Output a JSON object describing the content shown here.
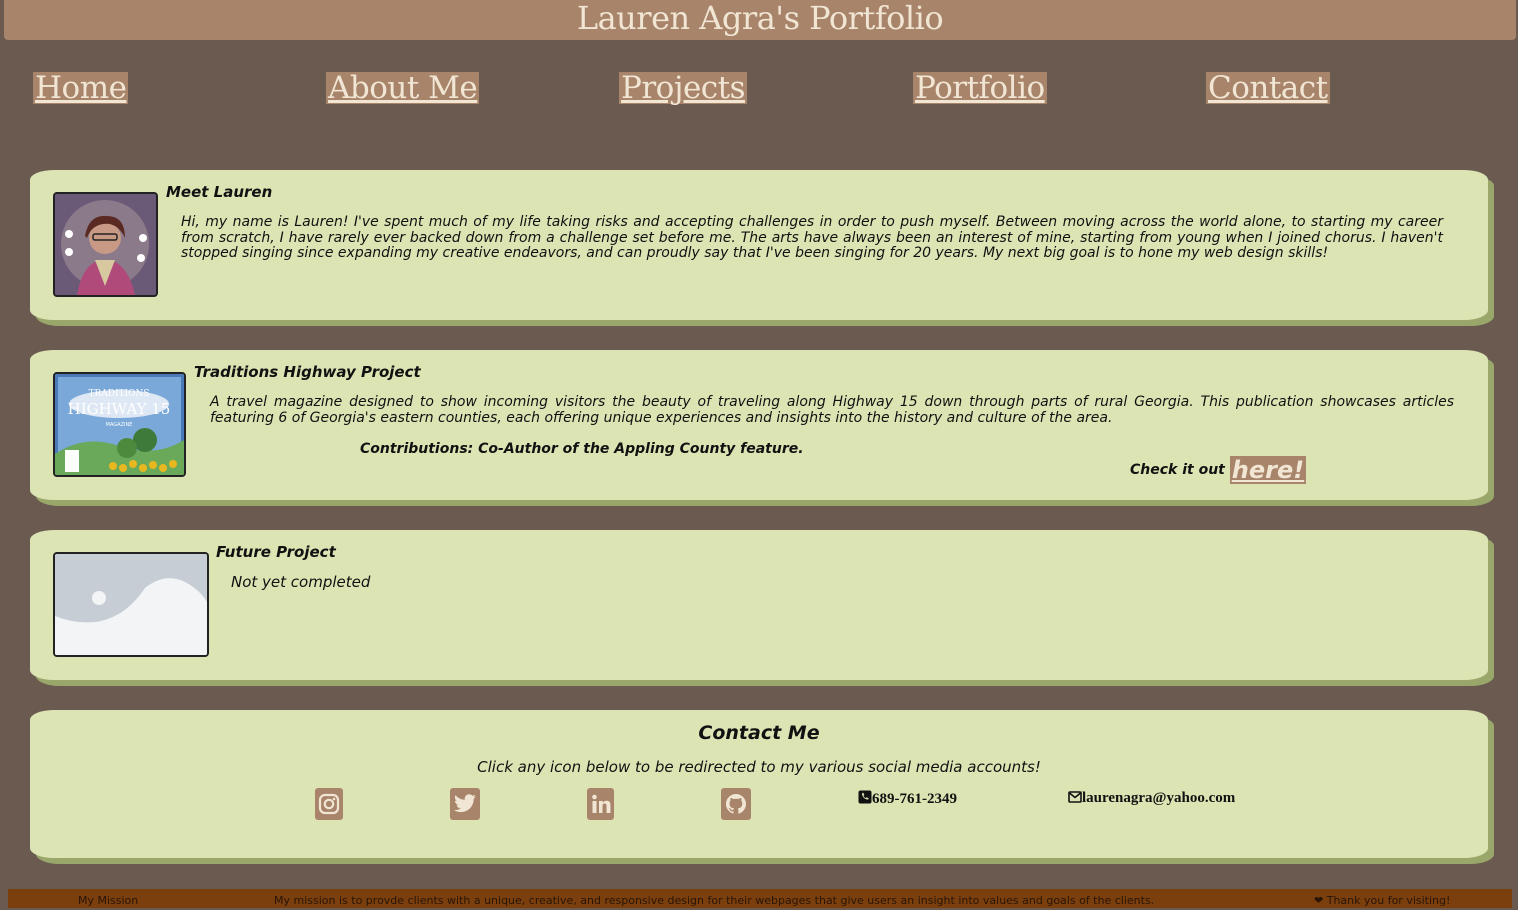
{
  "header": {
    "title": "Lauren Agra's Portfolio"
  },
  "nav": {
    "items": [
      {
        "label": "Home"
      },
      {
        "label": "About Me"
      },
      {
        "label": "Projects"
      },
      {
        "label": "Portfolio"
      },
      {
        "label": "Contact"
      }
    ]
  },
  "about": {
    "title": "Meet Lauren",
    "text": "Hi, my name is Lauren! I've spent much of my life taking risks and accepting challenges in order to push myself. Between moving across the world alone, to starting my career from scratch, I have rarely ever backed down from a challenge set before me. The arts have always been an interest of mine, starting from young when I joined chorus. I haven't stopped singing since expanding my creative endeavors, and can proudly say that I've been singing for 20 years. My next big goal is to hone my web design skills!"
  },
  "project1": {
    "title": "Traditions Highway Project",
    "text": "A travel magazine designed to show incoming visitors the beauty of traveling along Highway 15 down through parts of rural Georgia. This publication showcases articles featuring 6 of Georgia's eastern counties, each offering unique experiences and insights into the history and culture of the area.",
    "contributions": "Contributions: Co-Author of the Appling County feature.",
    "check_label": "Check it out",
    "link_label": "here!",
    "cover_text_1": "TRADITIONS",
    "cover_text_2": "HIGHWAY 15",
    "cover_text_3": "MAGAZINE"
  },
  "project2": {
    "title": "Future Project",
    "text": "Not yet completed"
  },
  "contact": {
    "title": "Contact Me",
    "subtitle": "Click any icon below to be redirected to my various social media accounts!",
    "phone": "689-761-2349",
    "email": "laurenagra@yahoo.com",
    "icons": [
      "instagram-icon",
      "twitter-icon",
      "linkedin-icon",
      "github-icon"
    ]
  },
  "footer": {
    "mission_label": "My Mission",
    "mission_text": "My mission is to provde clients with a unique, creative, and responsive design for their webpages that give users an insight into values and goals of the clients.",
    "thanks": "Thank you for visiting!"
  },
  "colors": {
    "background": "#6b5a50",
    "accent": "#a8846a",
    "card": "#dde4b4",
    "card_shadow": "#99a86a",
    "footer": "#7a3f0c"
  }
}
